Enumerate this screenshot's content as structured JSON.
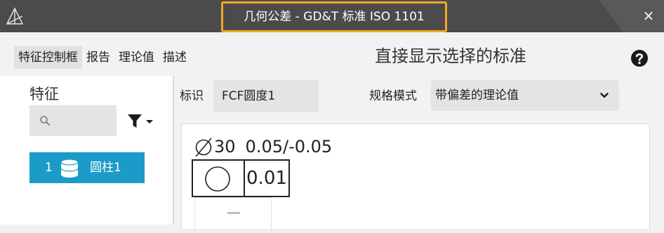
{
  "window": {
    "title": "几何公差 - GD&T 标准 ISO 1101",
    "close_glyph": "×",
    "accent_color": "#f5a623",
    "logo_icon": "app-logo-icon"
  },
  "tabs": [
    {
      "label": "特征控制框",
      "active": true
    },
    {
      "label": "报告",
      "active": false
    },
    {
      "label": "理论值",
      "active": false
    },
    {
      "label": "描述",
      "active": false
    }
  ],
  "standard_note": "直接显示选择的标准",
  "help_icon": "question-circle-icon",
  "features_panel": {
    "heading": "特征",
    "search_placeholder": "",
    "filter_icon": "filter-icon",
    "items": [
      {
        "index": "1",
        "icon": "cylinder-icon",
        "name": "圆柱1",
        "color": "#1b9bc8"
      }
    ]
  },
  "properties": {
    "id_label": "标识",
    "id_value": "FCF圆度1",
    "mode_label": "规格模式",
    "mode_value": "带偏差的理论值"
  },
  "fcf": {
    "dimension_symbol": "diameter-icon",
    "dimension_nominal": "30",
    "dimension_tolerance": "0.05/-0.05",
    "characteristic_icon": "circularity-icon",
    "tolerance_value": "0.01",
    "placeholder_glyph": "dash-icon"
  }
}
